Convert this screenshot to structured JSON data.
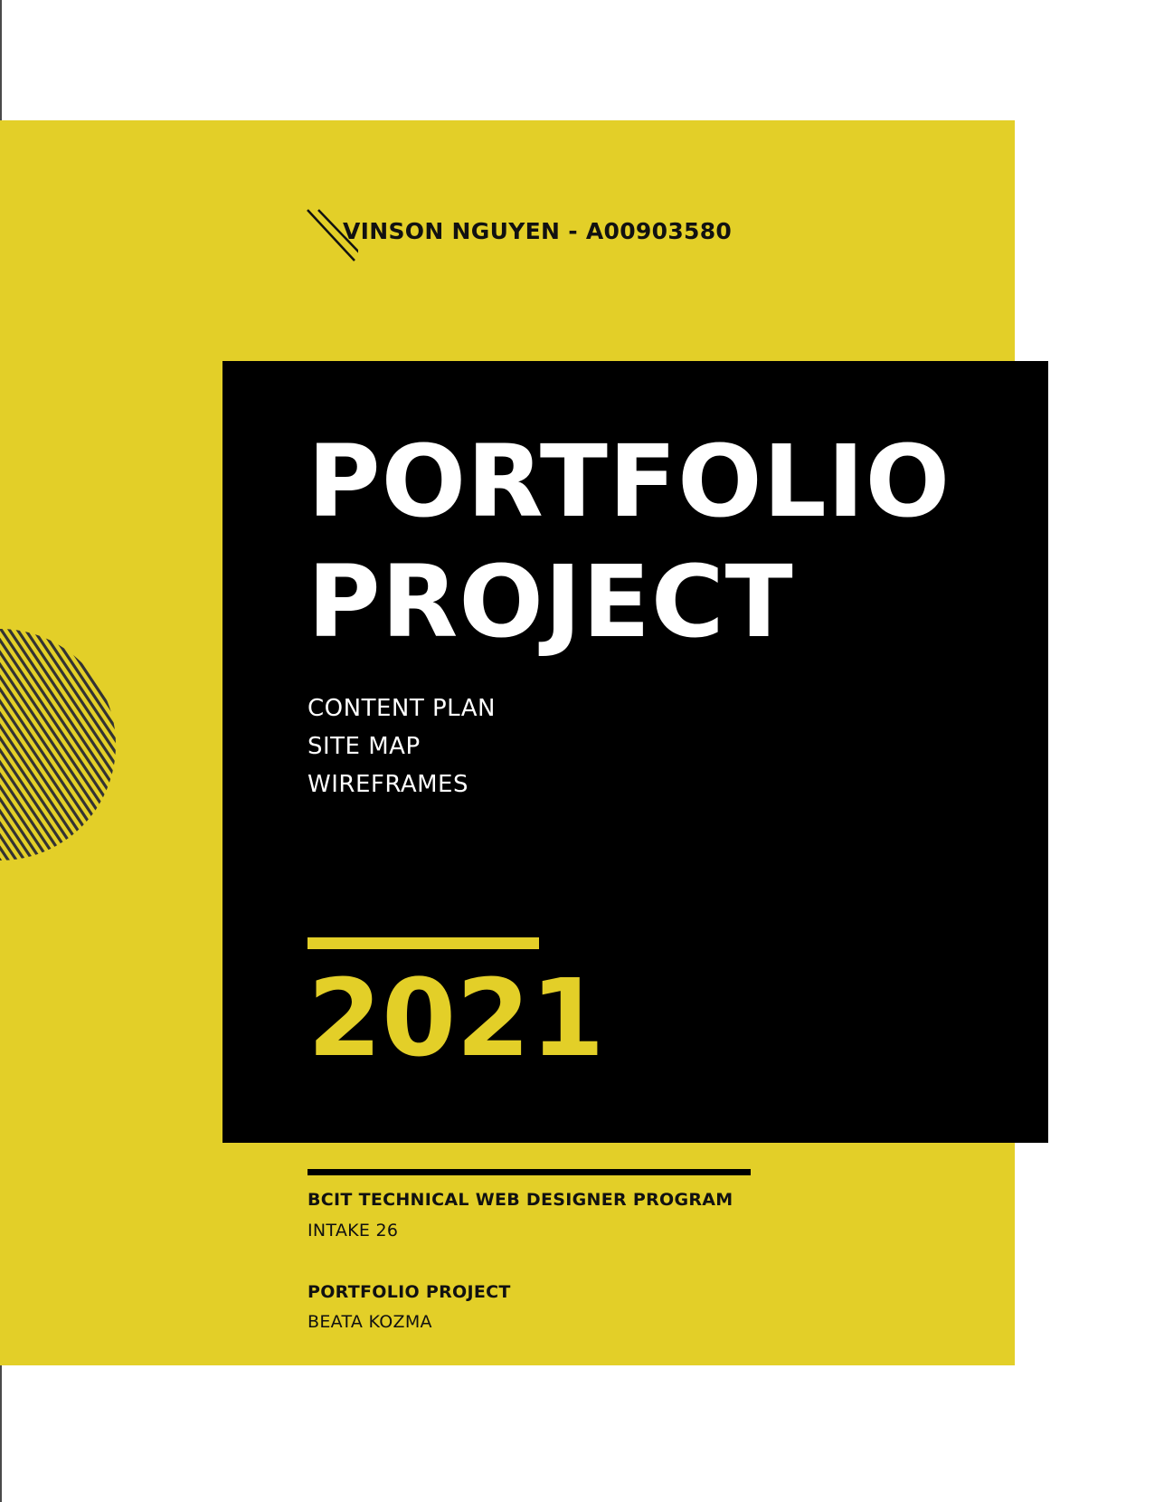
{
  "cover": {
    "author": "VINSON NGUYEN - A00903580",
    "title_line_1": "PORTFOLIO",
    "title_line_2": "PROJECT",
    "deliverables": [
      "CONTENT PLAN",
      "SITE MAP",
      "WIREFRAMES"
    ],
    "year": "2021"
  },
  "footer": {
    "program": "BCIT TECHNICAL WEB DESIGNER PROGRAM",
    "intake": "INTAKE 26",
    "course": "PORTFOLIO PROJECT",
    "instructor": "BEATA KOZMA"
  },
  "colors": {
    "accent_yellow": "#e3cf28",
    "panel_black": "#000000",
    "text_white": "#ffffff",
    "text_dark": "#111111"
  },
  "icons": {
    "author_mark": "double-slash-icon",
    "decoration": "striped-sphere-icon"
  }
}
